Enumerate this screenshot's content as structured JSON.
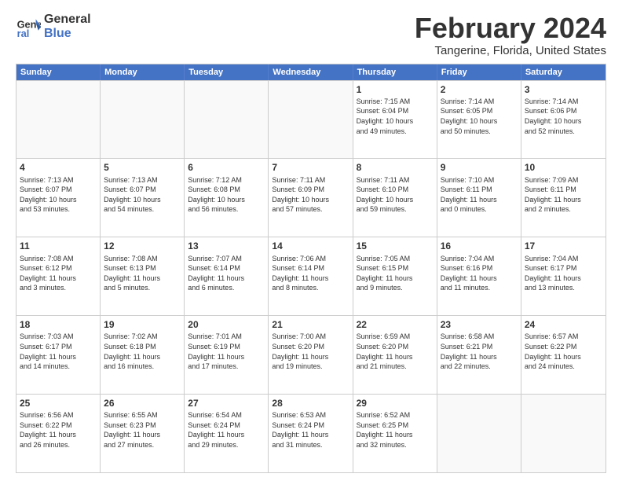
{
  "logo": {
    "line1": "General",
    "line2": "Blue"
  },
  "title": "February 2024",
  "subtitle": "Tangerine, Florida, United States",
  "headers": [
    "Sunday",
    "Monday",
    "Tuesday",
    "Wednesday",
    "Thursday",
    "Friday",
    "Saturday"
  ],
  "rows": [
    [
      {
        "day": "",
        "text": ""
      },
      {
        "day": "",
        "text": ""
      },
      {
        "day": "",
        "text": ""
      },
      {
        "day": "",
        "text": ""
      },
      {
        "day": "1",
        "text": "Sunrise: 7:15 AM\nSunset: 6:04 PM\nDaylight: 10 hours\nand 49 minutes."
      },
      {
        "day": "2",
        "text": "Sunrise: 7:14 AM\nSunset: 6:05 PM\nDaylight: 10 hours\nand 50 minutes."
      },
      {
        "day": "3",
        "text": "Sunrise: 7:14 AM\nSunset: 6:06 PM\nDaylight: 10 hours\nand 52 minutes."
      }
    ],
    [
      {
        "day": "4",
        "text": "Sunrise: 7:13 AM\nSunset: 6:07 PM\nDaylight: 10 hours\nand 53 minutes."
      },
      {
        "day": "5",
        "text": "Sunrise: 7:13 AM\nSunset: 6:07 PM\nDaylight: 10 hours\nand 54 minutes."
      },
      {
        "day": "6",
        "text": "Sunrise: 7:12 AM\nSunset: 6:08 PM\nDaylight: 10 hours\nand 56 minutes."
      },
      {
        "day": "7",
        "text": "Sunrise: 7:11 AM\nSunset: 6:09 PM\nDaylight: 10 hours\nand 57 minutes."
      },
      {
        "day": "8",
        "text": "Sunrise: 7:11 AM\nSunset: 6:10 PM\nDaylight: 10 hours\nand 59 minutes."
      },
      {
        "day": "9",
        "text": "Sunrise: 7:10 AM\nSunset: 6:11 PM\nDaylight: 11 hours\nand 0 minutes."
      },
      {
        "day": "10",
        "text": "Sunrise: 7:09 AM\nSunset: 6:11 PM\nDaylight: 11 hours\nand 2 minutes."
      }
    ],
    [
      {
        "day": "11",
        "text": "Sunrise: 7:08 AM\nSunset: 6:12 PM\nDaylight: 11 hours\nand 3 minutes."
      },
      {
        "day": "12",
        "text": "Sunrise: 7:08 AM\nSunset: 6:13 PM\nDaylight: 11 hours\nand 5 minutes."
      },
      {
        "day": "13",
        "text": "Sunrise: 7:07 AM\nSunset: 6:14 PM\nDaylight: 11 hours\nand 6 minutes."
      },
      {
        "day": "14",
        "text": "Sunrise: 7:06 AM\nSunset: 6:14 PM\nDaylight: 11 hours\nand 8 minutes."
      },
      {
        "day": "15",
        "text": "Sunrise: 7:05 AM\nSunset: 6:15 PM\nDaylight: 11 hours\nand 9 minutes."
      },
      {
        "day": "16",
        "text": "Sunrise: 7:04 AM\nSunset: 6:16 PM\nDaylight: 11 hours\nand 11 minutes."
      },
      {
        "day": "17",
        "text": "Sunrise: 7:04 AM\nSunset: 6:17 PM\nDaylight: 11 hours\nand 13 minutes."
      }
    ],
    [
      {
        "day": "18",
        "text": "Sunrise: 7:03 AM\nSunset: 6:17 PM\nDaylight: 11 hours\nand 14 minutes."
      },
      {
        "day": "19",
        "text": "Sunrise: 7:02 AM\nSunset: 6:18 PM\nDaylight: 11 hours\nand 16 minutes."
      },
      {
        "day": "20",
        "text": "Sunrise: 7:01 AM\nSunset: 6:19 PM\nDaylight: 11 hours\nand 17 minutes."
      },
      {
        "day": "21",
        "text": "Sunrise: 7:00 AM\nSunset: 6:20 PM\nDaylight: 11 hours\nand 19 minutes."
      },
      {
        "day": "22",
        "text": "Sunrise: 6:59 AM\nSunset: 6:20 PM\nDaylight: 11 hours\nand 21 minutes."
      },
      {
        "day": "23",
        "text": "Sunrise: 6:58 AM\nSunset: 6:21 PM\nDaylight: 11 hours\nand 22 minutes."
      },
      {
        "day": "24",
        "text": "Sunrise: 6:57 AM\nSunset: 6:22 PM\nDaylight: 11 hours\nand 24 minutes."
      }
    ],
    [
      {
        "day": "25",
        "text": "Sunrise: 6:56 AM\nSunset: 6:22 PM\nDaylight: 11 hours\nand 26 minutes."
      },
      {
        "day": "26",
        "text": "Sunrise: 6:55 AM\nSunset: 6:23 PM\nDaylight: 11 hours\nand 27 minutes."
      },
      {
        "day": "27",
        "text": "Sunrise: 6:54 AM\nSunset: 6:24 PM\nDaylight: 11 hours\nand 29 minutes."
      },
      {
        "day": "28",
        "text": "Sunrise: 6:53 AM\nSunset: 6:24 PM\nDaylight: 11 hours\nand 31 minutes."
      },
      {
        "day": "29",
        "text": "Sunrise: 6:52 AM\nSunset: 6:25 PM\nDaylight: 11 hours\nand 32 minutes."
      },
      {
        "day": "",
        "text": ""
      },
      {
        "day": "",
        "text": ""
      }
    ]
  ]
}
